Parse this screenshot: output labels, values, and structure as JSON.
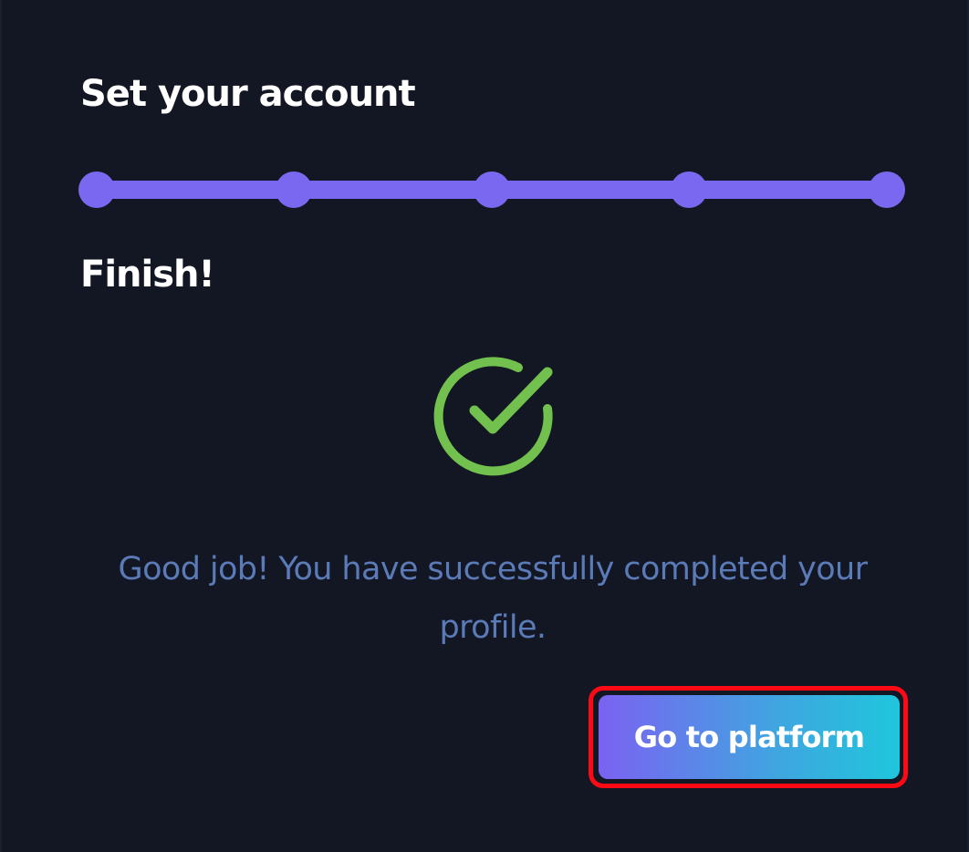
{
  "header": {
    "title": "Set your account"
  },
  "stepper": {
    "total_steps": 5,
    "completed_steps": 5,
    "accent_color": "#7b68f0"
  },
  "status": {
    "heading": "Finish!",
    "icon": "check-circle-icon",
    "icon_color": "#72c04e",
    "message": "Good job! You have successfully completed your profile.",
    "message_color": "#5b7ab8"
  },
  "actions": {
    "primary_label": "Go to platform",
    "gradient_start": "#7b62f2",
    "gradient_end": "#1fc6dc",
    "highlight_color": "#ff0a14"
  },
  "theme": {
    "background": "#121723"
  }
}
